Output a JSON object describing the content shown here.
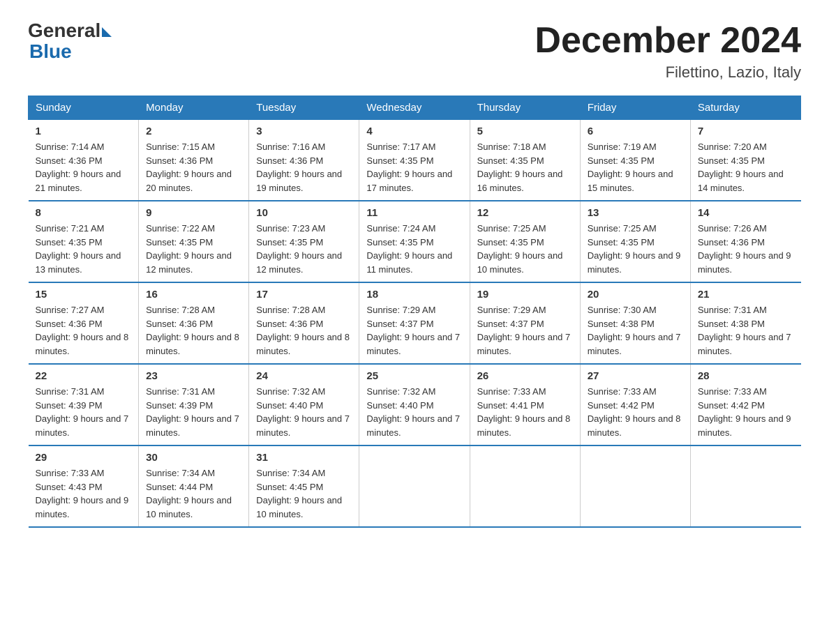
{
  "logo": {
    "general": "General",
    "blue": "Blue"
  },
  "header": {
    "month": "December 2024",
    "location": "Filettino, Lazio, Italy"
  },
  "weekdays": [
    "Sunday",
    "Monday",
    "Tuesday",
    "Wednesday",
    "Thursday",
    "Friday",
    "Saturday"
  ],
  "weeks": [
    [
      {
        "day": "1",
        "sunrise": "7:14 AM",
        "sunset": "4:36 PM",
        "daylight": "9 hours and 21 minutes."
      },
      {
        "day": "2",
        "sunrise": "7:15 AM",
        "sunset": "4:36 PM",
        "daylight": "9 hours and 20 minutes."
      },
      {
        "day": "3",
        "sunrise": "7:16 AM",
        "sunset": "4:36 PM",
        "daylight": "9 hours and 19 minutes."
      },
      {
        "day": "4",
        "sunrise": "7:17 AM",
        "sunset": "4:35 PM",
        "daylight": "9 hours and 17 minutes."
      },
      {
        "day": "5",
        "sunrise": "7:18 AM",
        "sunset": "4:35 PM",
        "daylight": "9 hours and 16 minutes."
      },
      {
        "day": "6",
        "sunrise": "7:19 AM",
        "sunset": "4:35 PM",
        "daylight": "9 hours and 15 minutes."
      },
      {
        "day": "7",
        "sunrise": "7:20 AM",
        "sunset": "4:35 PM",
        "daylight": "9 hours and 14 minutes."
      }
    ],
    [
      {
        "day": "8",
        "sunrise": "7:21 AM",
        "sunset": "4:35 PM",
        "daylight": "9 hours and 13 minutes."
      },
      {
        "day": "9",
        "sunrise": "7:22 AM",
        "sunset": "4:35 PM",
        "daylight": "9 hours and 12 minutes."
      },
      {
        "day": "10",
        "sunrise": "7:23 AM",
        "sunset": "4:35 PM",
        "daylight": "9 hours and 12 minutes."
      },
      {
        "day": "11",
        "sunrise": "7:24 AM",
        "sunset": "4:35 PM",
        "daylight": "9 hours and 11 minutes."
      },
      {
        "day": "12",
        "sunrise": "7:25 AM",
        "sunset": "4:35 PM",
        "daylight": "9 hours and 10 minutes."
      },
      {
        "day": "13",
        "sunrise": "7:25 AM",
        "sunset": "4:35 PM",
        "daylight": "9 hours and 9 minutes."
      },
      {
        "day": "14",
        "sunrise": "7:26 AM",
        "sunset": "4:36 PM",
        "daylight": "9 hours and 9 minutes."
      }
    ],
    [
      {
        "day": "15",
        "sunrise": "7:27 AM",
        "sunset": "4:36 PM",
        "daylight": "9 hours and 8 minutes."
      },
      {
        "day": "16",
        "sunrise": "7:28 AM",
        "sunset": "4:36 PM",
        "daylight": "9 hours and 8 minutes."
      },
      {
        "day": "17",
        "sunrise": "7:28 AM",
        "sunset": "4:36 PM",
        "daylight": "9 hours and 8 minutes."
      },
      {
        "day": "18",
        "sunrise": "7:29 AM",
        "sunset": "4:37 PM",
        "daylight": "9 hours and 7 minutes."
      },
      {
        "day": "19",
        "sunrise": "7:29 AM",
        "sunset": "4:37 PM",
        "daylight": "9 hours and 7 minutes."
      },
      {
        "day": "20",
        "sunrise": "7:30 AM",
        "sunset": "4:38 PM",
        "daylight": "9 hours and 7 minutes."
      },
      {
        "day": "21",
        "sunrise": "7:31 AM",
        "sunset": "4:38 PM",
        "daylight": "9 hours and 7 minutes."
      }
    ],
    [
      {
        "day": "22",
        "sunrise": "7:31 AM",
        "sunset": "4:39 PM",
        "daylight": "9 hours and 7 minutes."
      },
      {
        "day": "23",
        "sunrise": "7:31 AM",
        "sunset": "4:39 PM",
        "daylight": "9 hours and 7 minutes."
      },
      {
        "day": "24",
        "sunrise": "7:32 AM",
        "sunset": "4:40 PM",
        "daylight": "9 hours and 7 minutes."
      },
      {
        "day": "25",
        "sunrise": "7:32 AM",
        "sunset": "4:40 PM",
        "daylight": "9 hours and 7 minutes."
      },
      {
        "day": "26",
        "sunrise": "7:33 AM",
        "sunset": "4:41 PM",
        "daylight": "9 hours and 8 minutes."
      },
      {
        "day": "27",
        "sunrise": "7:33 AM",
        "sunset": "4:42 PM",
        "daylight": "9 hours and 8 minutes."
      },
      {
        "day": "28",
        "sunrise": "7:33 AM",
        "sunset": "4:42 PM",
        "daylight": "9 hours and 9 minutes."
      }
    ],
    [
      {
        "day": "29",
        "sunrise": "7:33 AM",
        "sunset": "4:43 PM",
        "daylight": "9 hours and 9 minutes."
      },
      {
        "day": "30",
        "sunrise": "7:34 AM",
        "sunset": "4:44 PM",
        "daylight": "9 hours and 10 minutes."
      },
      {
        "day": "31",
        "sunrise": "7:34 AM",
        "sunset": "4:45 PM",
        "daylight": "9 hours and 10 minutes."
      },
      null,
      null,
      null,
      null
    ]
  ]
}
